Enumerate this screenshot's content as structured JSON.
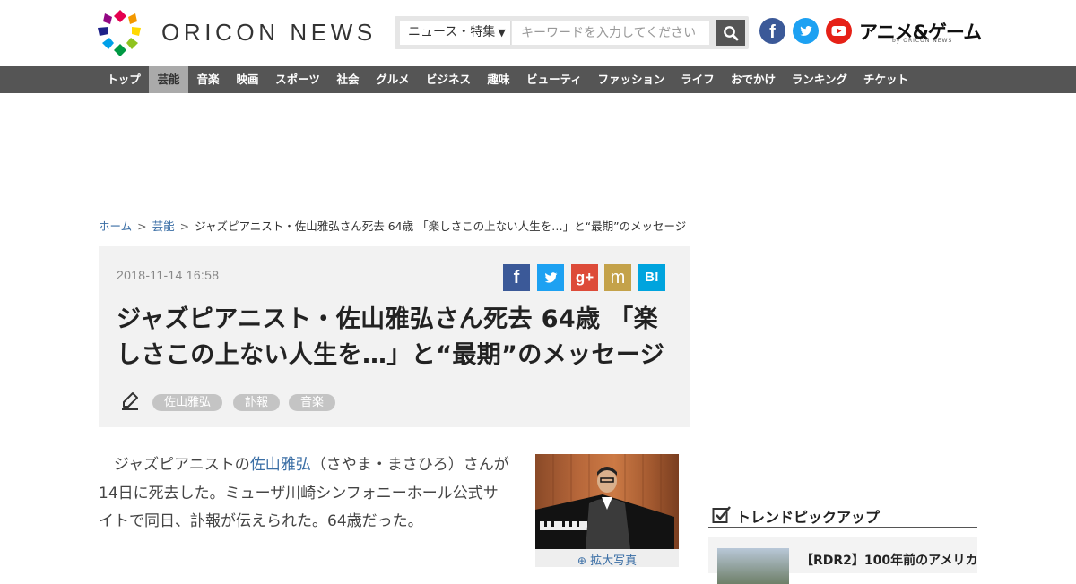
{
  "header": {
    "logo_text": "ORICON NEWS",
    "search": {
      "category_selected": "ニュース・特集",
      "placeholder": "キーワードを入力してください"
    },
    "social": {
      "facebook_glyph": "f",
      "facebook_color": "#3b5998",
      "twitter_color": "#1da1f2",
      "youtube_color": "#e62117"
    },
    "anime_link": "アニメ&ゲーム",
    "anime_link_sub": "by ORICON NEWS"
  },
  "nav": {
    "items": [
      "トップ",
      "芸能",
      "音楽",
      "映画",
      "スポーツ",
      "社会",
      "グルメ",
      "ビジネス",
      "趣味",
      "ビューティ",
      "ファッション",
      "ライフ",
      "おでかけ",
      "ランキング",
      "チケット"
    ],
    "active": "芸能"
  },
  "breadcrumb": {
    "home": "ホーム",
    "category": "芸能",
    "sep": ">",
    "current": "ジャズピアニスト・佐山雅弘さん死去 64歳 「楽しさこの上ない人生を…」と“最期”のメッセージ"
  },
  "article": {
    "date": "2018-11-14 16:58",
    "title": "ジャズピアニスト・佐山雅弘さん死去 64歳 「楽しさこの上ない人生を…」と“最期”のメッセージ",
    "tags": [
      "佐山雅弘",
      "訃報",
      "音楽"
    ],
    "share": {
      "facebook": "f",
      "googleplus": "g+",
      "mixi": "m",
      "hatena": "B!"
    },
    "share_colors": {
      "facebook": "#3b5998",
      "twitter": "#1da1f2",
      "googleplus": "#dd4b39",
      "mixi": "#c4a24a",
      "hatena": "#00a4de"
    },
    "body_prefix": "ジャズピアニストの",
    "body_link": "佐山雅弘",
    "body_rest": "（さやま・まさひろ）さんが14日に死去した。ミューザ川崎シンフォニーホール公式サイトで同日、訃報が伝えられた。64歳だった。",
    "photo_zoom_label": "拡大写真"
  },
  "sidebar": {
    "trend_title": "トレンドピックアップ",
    "trend_item": "【RDR2】100年前のアメリカ"
  }
}
